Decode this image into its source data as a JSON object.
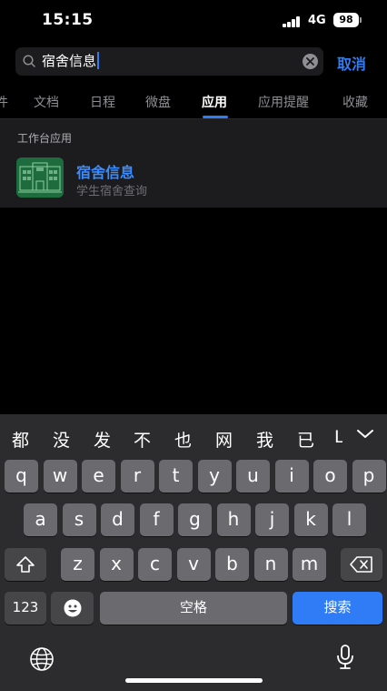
{
  "status_bar": {
    "time": "15:15",
    "network": "4G",
    "battery": "98"
  },
  "search": {
    "query": "宿舍信息",
    "cancel_label": "取消"
  },
  "tabs": [
    {
      "label": "件",
      "active": false
    },
    {
      "label": "文档",
      "active": false
    },
    {
      "label": "日程",
      "active": false
    },
    {
      "label": "微盘",
      "active": false
    },
    {
      "label": "应用",
      "active": true
    },
    {
      "label": "应用提醒",
      "active": false
    },
    {
      "label": "收藏",
      "active": false
    }
  ],
  "results": {
    "section_label": "工作台应用",
    "items": [
      {
        "name": "宿舍信息",
        "description": "学生宿舍查询"
      }
    ]
  },
  "keyboard": {
    "candidates": [
      "都",
      "没",
      "发",
      "不",
      "也",
      "网",
      "我",
      "已",
      "L"
    ],
    "row1": [
      "q",
      "w",
      "e",
      "r",
      "t",
      "y",
      "u",
      "i",
      "o",
      "p"
    ],
    "row2": [
      "a",
      "s",
      "d",
      "f",
      "g",
      "h",
      "j",
      "k",
      "l"
    ],
    "row3": [
      "z",
      "x",
      "c",
      "v",
      "b",
      "n",
      "m"
    ],
    "numbers_label": "123",
    "space_label": "空格",
    "search_label": "搜索"
  },
  "colors": {
    "accent": "#2f7cf6",
    "app_icon_bg": "#1e6b3e",
    "key": "#6b6b6f",
    "key_dark": "#464649"
  }
}
